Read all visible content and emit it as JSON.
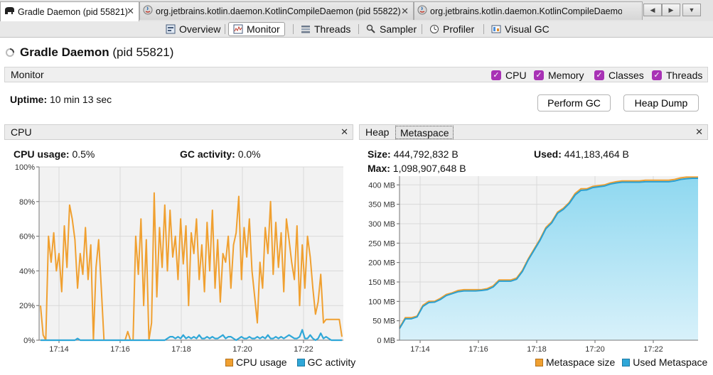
{
  "doc_tabs": [
    {
      "label": "Gradle Daemon (pid 55821)",
      "active": true
    },
    {
      "label": "org.jetbrains.kotlin.daemon.KotlinCompileDaemon (pid 55822)",
      "active": false
    },
    {
      "label": "org.jetbrains.kotlin.daemon.KotlinCompileDaemon (p...",
      "active": false
    }
  ],
  "view_tabs": [
    {
      "label": "Overview",
      "icon": "overview-icon"
    },
    {
      "label": "Monitor",
      "icon": "monitor-icon",
      "active": true
    },
    {
      "label": "Threads",
      "icon": "threads-icon"
    },
    {
      "label": "Sampler",
      "icon": "sampler-icon"
    },
    {
      "label": "Profiler",
      "icon": "profiler-icon"
    },
    {
      "label": "Visual GC",
      "icon": "visual-gc-icon"
    }
  ],
  "app": {
    "name": "Gradle Daemon",
    "pid": "(pid 55821)"
  },
  "monitor": {
    "label": "Monitor",
    "checkboxes": [
      "CPU",
      "Memory",
      "Classes",
      "Threads"
    ],
    "uptime_label": "Uptime:",
    "uptime_value": "10 min 13 sec",
    "perform_gc": "Perform GC",
    "heap_dump": "Heap Dump"
  },
  "cpu_panel": {
    "title": "CPU",
    "cpu_usage_label": "CPU usage:",
    "cpu_usage_value": "0.5%",
    "gc_activity_label": "GC activity:",
    "gc_activity_value": "0.0%"
  },
  "mem_panel": {
    "tab_heap": "Heap",
    "tab_metaspace": "Metaspace",
    "size_label": "Size:",
    "size_value": "444,792,832 B",
    "used_label": "Used:",
    "used_value": "441,183,464 B",
    "max_label": "Max:",
    "max_value": "1,098,907,648 B"
  },
  "colors": {
    "cpu": "#f0a030",
    "gc": "#2fa7d8",
    "meta_fill": "#a6e0f3",
    "meta_line": "#2b9fd0",
    "meta_size": "#f0a030"
  },
  "chart_data": [
    {
      "type": "line",
      "ylim": [
        0,
        100
      ],
      "yticks": [
        "0%",
        "20%",
        "40%",
        "60%",
        "80%",
        "100%"
      ],
      "xticks": [
        "17:14",
        "17:16",
        "17:18",
        "17:20",
        "17:22"
      ],
      "series": [
        {
          "name": "CPU usage",
          "values": [
            20,
            3,
            0,
            60,
            45,
            62,
            40,
            50,
            28,
            66,
            42,
            78,
            70,
            58,
            30,
            50,
            38,
            65,
            35,
            55,
            0,
            42,
            58,
            30,
            0,
            0,
            0,
            0,
            0,
            0,
            0,
            0,
            0,
            5,
            0,
            0,
            60,
            38,
            70,
            20,
            58,
            0,
            10,
            85,
            25,
            65,
            42,
            78,
            40,
            75,
            48,
            60,
            35,
            70,
            44,
            66,
            20,
            62,
            50,
            70,
            35,
            55,
            28,
            68,
            40,
            75,
            30,
            58,
            22,
            50,
            45,
            60,
            30,
            55,
            62,
            83,
            35,
            65,
            48,
            70,
            40,
            25,
            10,
            45,
            30,
            65,
            50,
            80,
            38,
            68,
            42,
            62,
            28,
            70,
            58,
            45,
            35,
            66,
            20,
            55,
            30,
            60,
            48,
            30,
            15,
            22,
            38,
            10,
            12,
            12,
            12,
            12,
            12,
            12,
            2
          ]
        },
        {
          "name": "GC activity",
          "values": [
            0,
            0,
            0,
            0,
            0,
            0,
            0,
            0,
            0,
            0,
            0,
            0,
            0,
            0,
            1,
            0,
            0,
            0,
            0,
            0,
            0,
            0,
            0,
            0,
            0,
            0,
            0,
            0,
            0,
            0,
            0,
            0,
            0,
            0,
            0,
            0,
            0,
            0,
            0,
            0,
            0,
            0,
            0,
            0,
            0,
            0,
            0,
            0,
            1,
            2,
            2,
            1,
            2,
            1,
            3,
            1,
            2,
            1,
            2,
            1,
            3,
            1,
            1,
            2,
            1,
            2,
            1,
            1,
            2,
            3,
            1,
            2,
            2,
            1,
            0,
            1,
            2,
            1,
            1,
            2,
            1,
            1,
            2,
            1,
            2,
            1,
            3,
            1,
            1,
            2,
            1,
            2,
            1,
            2,
            3,
            2,
            1,
            1,
            2,
            6,
            1,
            1,
            3,
            1,
            0,
            1,
            4,
            1,
            2,
            1,
            0,
            0,
            0,
            0,
            0
          ]
        }
      ]
    },
    {
      "type": "area",
      "ylim": [
        0,
        400
      ],
      "yticks": [
        "0 MB",
        "50 MB",
        "100 MB",
        "150 MB",
        "200 MB",
        "250 MB",
        "300 MB",
        "350 MB",
        "400 MB"
      ],
      "xticks": [
        "17:14",
        "17:16",
        "17:18",
        "17:20",
        "17:22"
      ],
      "series": [
        {
          "name": "Metaspace size",
          "values": [
            32,
            58,
            58,
            62,
            90,
            100,
            100,
            108,
            118,
            122,
            128,
            130,
            130,
            130,
            130,
            133,
            140,
            155,
            155,
            155,
            160,
            180,
            210,
            235,
            260,
            290,
            305,
            330,
            340,
            355,
            378,
            390,
            390,
            396,
            398,
            400,
            405,
            408,
            410,
            410,
            410,
            410,
            412,
            412,
            412,
            412,
            412,
            414,
            418,
            420,
            420,
            420
          ]
        },
        {
          "name": "Used Metaspace",
          "values": [
            30,
            55,
            55,
            60,
            87,
            97,
            98,
            105,
            115,
            120,
            125,
            127,
            127,
            127,
            128,
            130,
            137,
            152,
            152,
            152,
            157,
            177,
            207,
            232,
            257,
            287,
            302,
            327,
            337,
            352,
            374,
            386,
            387,
            393,
            395,
            397,
            402,
            405,
            407,
            407,
            407,
            407,
            408,
            408,
            408,
            408,
            408,
            410,
            414,
            416,
            417,
            417
          ]
        }
      ]
    }
  ],
  "legend": {
    "cpu": "CPU usage",
    "gc": "GC activity",
    "meta_size": "Metaspace size",
    "meta_used": "Used Metaspace"
  }
}
